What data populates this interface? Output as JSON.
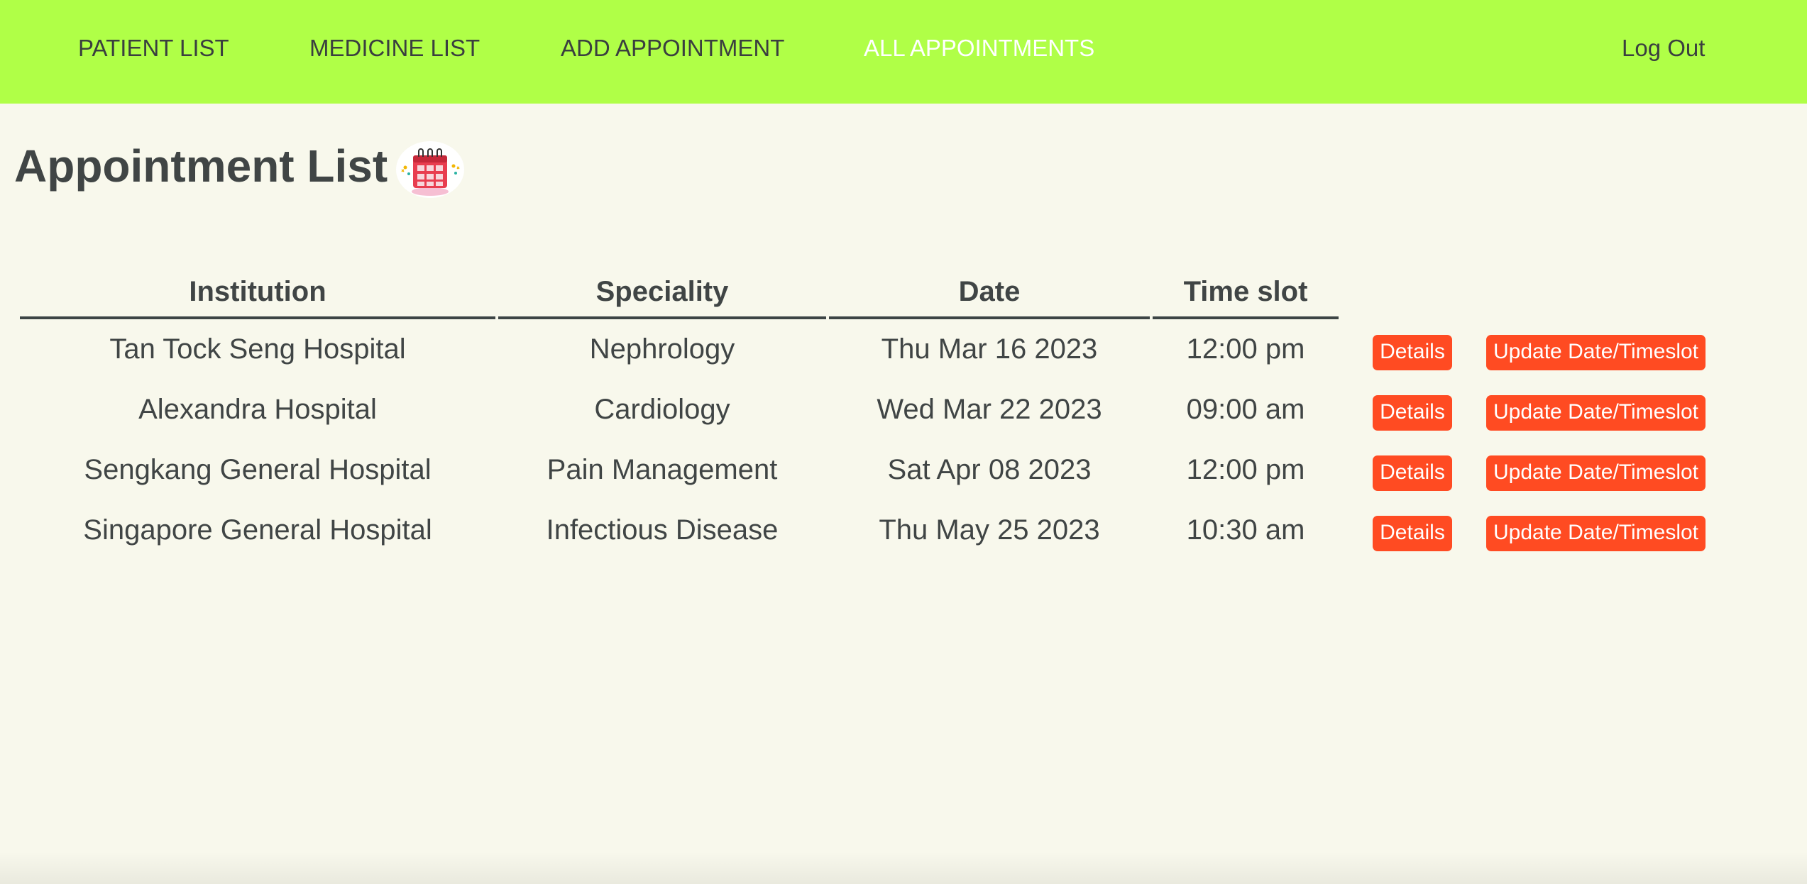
{
  "nav": {
    "links": [
      {
        "label": "PATIENT LIST"
      },
      {
        "label": "MEDICINE LIST"
      },
      {
        "label": "ADD APPOINTMENT"
      },
      {
        "label": "ALL APPOINTMENTS",
        "active": true
      }
    ],
    "logout_label": "Log Out",
    "background_color": "#b0ff47"
  },
  "page": {
    "title": "Appointment List",
    "title_icon": "calendar-icon"
  },
  "table": {
    "headers": [
      "Institution",
      "Speciality",
      "Date",
      "Time slot"
    ],
    "rows": [
      {
        "institution": "Tan Tock Seng Hospital",
        "speciality": "Nephrology",
        "date": "Thu Mar 16 2023",
        "time": "12:00 pm",
        "details_label": "Details",
        "update_label": "Update Date/Timeslot"
      },
      {
        "institution": "Alexandra Hospital",
        "speciality": "Cardiology",
        "date": "Wed Mar 22 2023",
        "time": "09:00 am",
        "details_label": "Details",
        "update_label": "Update Date/Timeslot"
      },
      {
        "institution": "Sengkang General Hospital",
        "speciality": "Pain Management",
        "date": "Sat Apr 08 2023",
        "time": "12:00 pm",
        "details_label": "Details",
        "update_label": "Update Date/Timeslot"
      },
      {
        "institution": "Singapore General Hospital",
        "speciality": "Infectious Disease",
        "date": "Thu May 25 2023",
        "time": "10:30 am",
        "details_label": "Details",
        "update_label": "Update Date/Timeslot"
      }
    ]
  },
  "colors": {
    "page_background": "#f8f8ec",
    "button": "#ff4b22",
    "text": "#404545"
  }
}
